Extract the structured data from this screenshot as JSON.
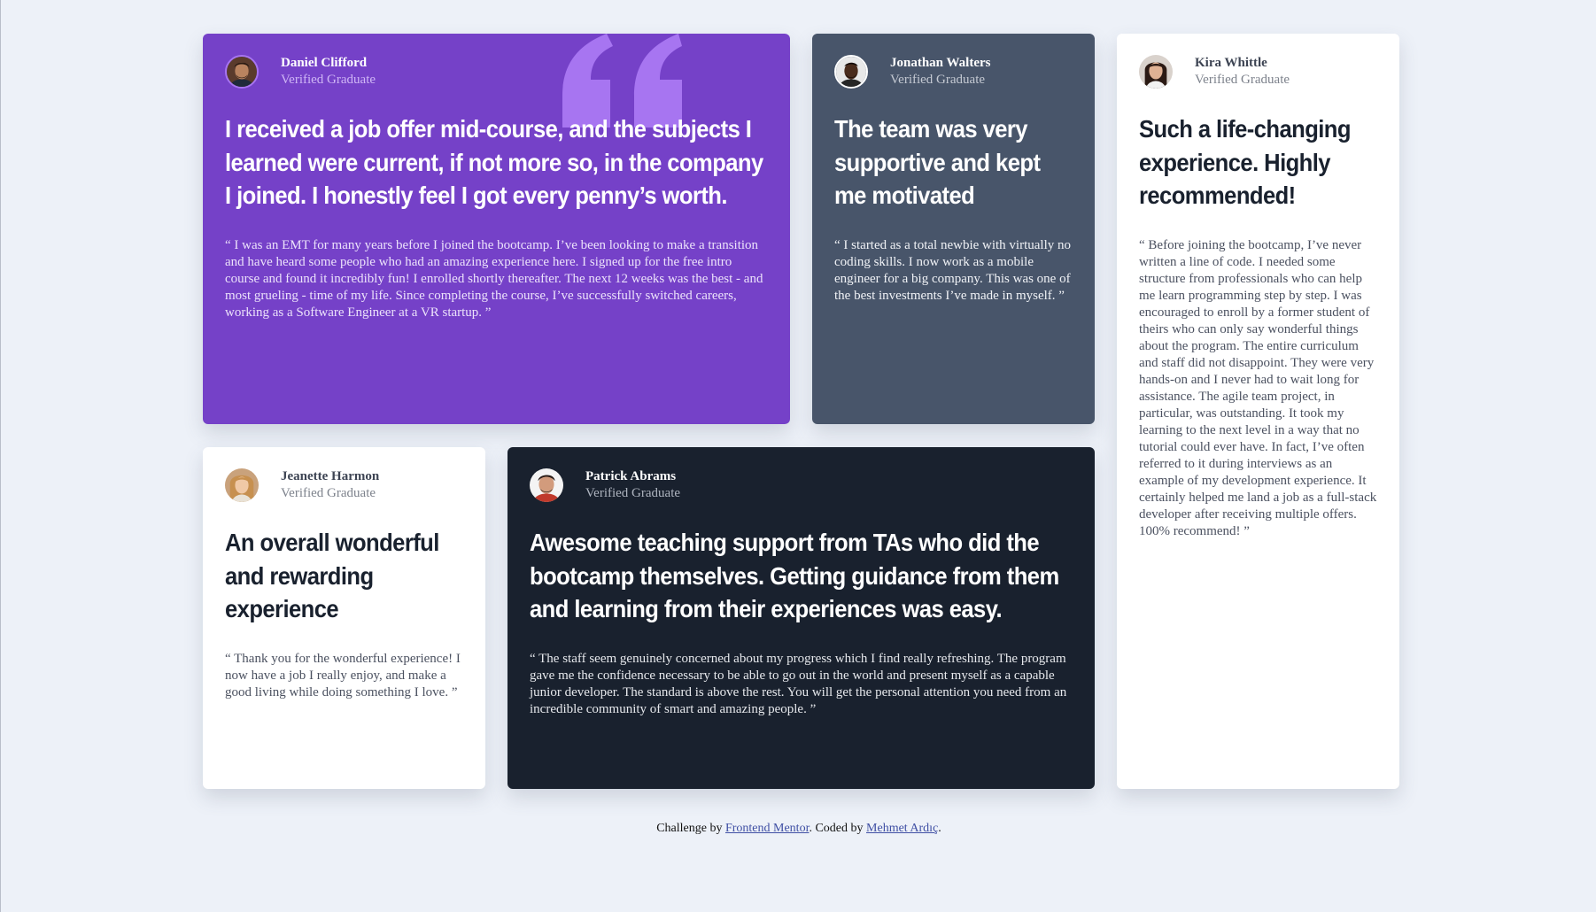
{
  "colors": {
    "page_background": "#edf1f8",
    "moderate_violet": "#7541c8",
    "grayish_blue": "#48556a",
    "very_dark_blackish_blue": "#19212e",
    "white": "#ffffff",
    "quote_mark": "#a775f1"
  },
  "testimonials": [
    {
      "name": "Daniel Clifford",
      "role": "Verified Graduate",
      "avatar_icon": "man-portrait-avatar",
      "headline": "I received a job offer mid-course, and the subjects I learned were current, if not more so, in the company I joined. I honestly feel I got every penny’s worth.",
      "quote": "“ I was an EMT for many years before I joined the bootcamp. I’ve been looking to make a transition and have heard some people who had an amazing experience here. I signed up for the free intro course and found it incredibly fun! I enrolled shortly thereafter. The next 12 weeks was the best - and most grueling - time of my life. Since completing the course, I’ve successfully switched careers, working as a Software Engineer at a VR startup. ”"
    },
    {
      "name": "Jonathan Walters",
      "role": "Verified Graduate",
      "avatar_icon": "man-portrait-avatar",
      "headline": "The team was very supportive and kept me motivated",
      "quote": "“ I started as a total newbie with virtually no coding skills. I now work as a mobile engineer for a big company. This was one of the best investments I’ve made in myself. ”"
    },
    {
      "name": "Kira Whittle",
      "role": "Verified Graduate",
      "avatar_icon": "woman-portrait-avatar",
      "headline": "Such a life-changing experience. Highly recommended!",
      "quote": "“ Before joining the bootcamp, I’ve never written a line of code. I needed some structure from professionals who can help me learn programming step by step. I was encouraged to enroll by a former student of theirs who can only say wonderful things about the program. The entire curriculum and staff did not disappoint. They were very hands-on and I never had to wait long for assistance. The agile team project, in particular, was outstanding. It took my learning to the next level in a way that no tutorial could ever have. In fact, I’ve often referred to it during interviews as an example of my development experience. It certainly helped me land a job as a full-stack developer after receiving multiple offers. 100% recommend! ”"
    },
    {
      "name": "Jeanette Harmon",
      "role": "Verified Graduate",
      "avatar_icon": "woman-portrait-avatar",
      "headline": "An overall wonderful and rewarding experience",
      "quote": "“ Thank you for the wonderful experience! I now have a job I really enjoy, and make a good living while doing something I love. ”"
    },
    {
      "name": "Patrick Abrams",
      "role": "Verified Graduate",
      "avatar_icon": "man-portrait-avatar",
      "headline": "Awesome teaching support from TAs who did the bootcamp themselves. Getting guidance from them and learning from their experiences was easy.",
      "quote": "“ The staff seem genuinely concerned about my progress which I find really refreshing. The program gave me the confidence necessary to be able to go out in the world and present myself as a capable junior developer. The standard is above the rest. You will get the personal attention you need from an incredible community of smart and amazing people. ”"
    }
  ],
  "decoration": {
    "quote_icon": "quotation-mark-icon"
  },
  "footer": {
    "prefix": "Challenge by ",
    "link1_label": "Frontend Mentor",
    "middle": ". Coded by ",
    "link2_label": "Mehmet Ardıç",
    "suffix": "."
  }
}
